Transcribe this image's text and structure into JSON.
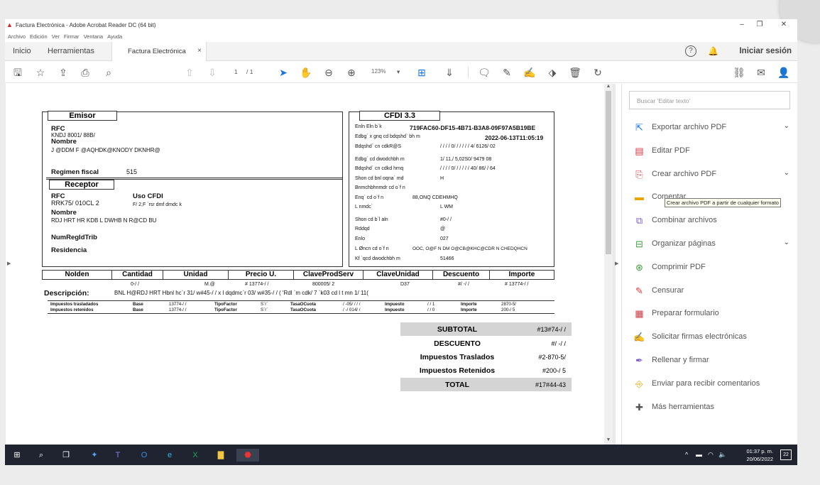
{
  "window": {
    "title": "Factura Electrónica - Adobe Acrobat Reader DC (64 bit)",
    "menu": [
      "Archivo",
      "Edición",
      "Ver",
      "Firmar",
      "Ventana",
      "Ayuda"
    ]
  },
  "tabs": {
    "home": "Inicio",
    "tools": "Herramientas",
    "document": "Factura Electrónica",
    "signin": "Iniciar sesión"
  },
  "toolbar": {
    "page_current": "1",
    "page_total": "/ 1",
    "zoom": "123%"
  },
  "invoice": {
    "emisor_title": "Emisor",
    "emisor_rfc_label": "RFC",
    "emisor_rfc": "KNDJ 8001/ 88B/",
    "emisor_nombre_label": "Nombre",
    "emisor_nombre": "J @DDM F @AQHDK@KNODY DKNHR@",
    "regimen_label": "Regimen fiscal",
    "regimen_value": "515",
    "receptor_title": "Receptor",
    "receptor_rfc_label": "RFC",
    "receptor_rfc": "RRK75/ 010CL 2",
    "uso_label": "Uso CFDI",
    "uso_value": "F/ 2,F `rsr dmf dmdc k",
    "receptor_nombre_label": "Nombre",
    "receptor_nombre": "RDJ HRT HR KDB L DWHB N R@CD BU",
    "numregid_label": "NumRegIdTrib",
    "residencia_label": "Residencia",
    "cfdi_title": "CFDI 3.3",
    "cfdi_rows": [
      {
        "label": "Enln Eln b`k",
        "value": "719FAC60-DF15-4B71-B3A8-09F97A5B19BE",
        "bold": true
      },
      {
        "label": "Edbg` x gnq cd bdqshd` bh m",
        "value": "2022-06-13T11:05:19",
        "bold": true
      },
      {
        "label": "Bdqshd` cn cdkR@S",
        "value": "/ / / / 0/ / / / / / 4/ 6126/ 02",
        "bold": false
      },
      {
        "label": "Edbg` cd dwodchbh m",
        "value": "1/ 11,/ 5,02S0/ 9479 08",
        "bold": false
      },
      {
        "label": "Bdqshd` cn cdkd hrnq",
        "value": "/ / / / 0/ / / / / / 40/ 86/ / 64",
        "bold": false
      },
      {
        "label": "Shon cd bnl oqna` md",
        "value": "H",
        "bold": false
      },
      {
        "label": "Bnmchbhnmdr cd o`f n",
        "value": "",
        "bold": false
      },
      {
        "label": "Enq` cd o`f n",
        "value": "88,ONQ CDEHMHQ",
        "bold": false
      },
      {
        "label": "L nmdc`",
        "value": "L WM",
        "bold": false
      },
      {
        "label": "Shon cd b`l aln",
        "value": "#0-/ /",
        "bold": false
      },
      {
        "label": "Rddqd",
        "value": "@",
        "bold": false
      },
      {
        "label": "Enlo",
        "value": "027",
        "bold": false
      },
      {
        "label": "L Øncn cd o`f n",
        "value": "OOC, O@F N DM O@CB@KHC@CDR N CHEDQHCN",
        "bold": false
      },
      {
        "label": "Kf `qcd dwodchbh m",
        "value": "51466",
        "bold": false
      }
    ],
    "concept_headers": [
      "NoIden",
      "Cantidad",
      "Unidad",
      "Precio U.",
      "ClaveProdServ",
      "ClaveUnidad",
      "Descuento",
      "Importe"
    ],
    "concept_values": [
      "0-/ /",
      "M.@",
      "# 13774-/ /",
      "800005/ 2",
      "D37",
      "#/ -/ /",
      "# 13774-/ /"
    ],
    "descripcion_label": "Descripción:",
    "descripcion_value": "BNL H@RDJ HRT Hbnl hc`r 31/ w#45-/ / x l dqdmc`r 03/ w#35-/ / ( 'Rdl `m cdk/ 7 `k03 cd l t mn 1/ 11(",
    "tax_rows": [
      [
        "Impuestos trasladados",
        "Base",
        "13774-/ /",
        "TipoFactor",
        "S`r`",
        "TasaOCuota",
        "/ -05/ / / /",
        "Impuesto",
        "/ / 1",
        "Importe",
        "2870-5/"
      ],
      [
        "Impuestos retenidos",
        "Base",
        "13774-/ /",
        "TipoFactor",
        "S`r`",
        "TasaOCuota",
        "/ -/ 014/ /",
        "Impuesto",
        "/ / 0",
        "Importe",
        "200-/ 5"
      ]
    ],
    "totals": [
      {
        "label": "SUBTOTAL",
        "value": "#13#74-/ /"
      },
      {
        "label": "DESCUENTO",
        "value": "#/ -/ /"
      },
      {
        "label": "Impuestos Traslados",
        "value": "#2-870-5/"
      },
      {
        "label": "Impuestos Retenidos",
        "value": "#200-/ 5"
      },
      {
        "label": "TOTAL",
        "value": "#17#44-43"
      }
    ]
  },
  "right_pane": {
    "search_placeholder": "Buscar 'Editar texto'",
    "tools": [
      {
        "label": "Exportar archivo PDF",
        "icon": "export-pdf-icon",
        "color": "#1473e6",
        "chevron": true
      },
      {
        "label": "Editar PDF",
        "icon": "edit-pdf-icon",
        "color": "#d7373f",
        "chevron": false
      },
      {
        "label": "Crear archivo PDF",
        "icon": "create-pdf-icon",
        "color": "#d7373f",
        "chevron": true
      },
      {
        "label": "Comentar",
        "icon": "comment-icon",
        "color": "#e8a500",
        "chevron": false
      },
      {
        "label": "Combinar archivos",
        "icon": "combine-files-icon",
        "color": "#7a5ad1",
        "chevron": false
      },
      {
        "label": "Organizar páginas",
        "icon": "organize-pages-icon",
        "color": "#3e9a3b",
        "chevron": true
      },
      {
        "label": "Comprimir PDF",
        "icon": "compress-pdf-icon",
        "color": "#3e9a3b",
        "chevron": false
      },
      {
        "label": "Censurar",
        "icon": "redact-icon",
        "color": "#d7373f",
        "chevron": false
      },
      {
        "label": "Preparar formulario",
        "icon": "prepare-form-icon",
        "color": "#d7373f",
        "chevron": false
      },
      {
        "label": "Solicitar firmas electrónicas",
        "icon": "request-signatures-icon",
        "color": "#7a5ad1",
        "chevron": false
      },
      {
        "label": "Rellenar y firmar",
        "icon": "fill-sign-icon",
        "color": "#7a5ad1",
        "chevron": false
      },
      {
        "label": "Enviar para recibir comentarios",
        "icon": "send-comments-icon",
        "color": "#e8a500",
        "chevron": false
      },
      {
        "label": "Más herramientas",
        "icon": "more-tools-icon",
        "color": "#555555",
        "chevron": false
      }
    ],
    "tooltip": "Crear archivo PDF a partir de cualquier formato"
  },
  "taskbar": {
    "time": "01:37 p. m.",
    "date": "20/06/2022",
    "notifications": "22"
  }
}
